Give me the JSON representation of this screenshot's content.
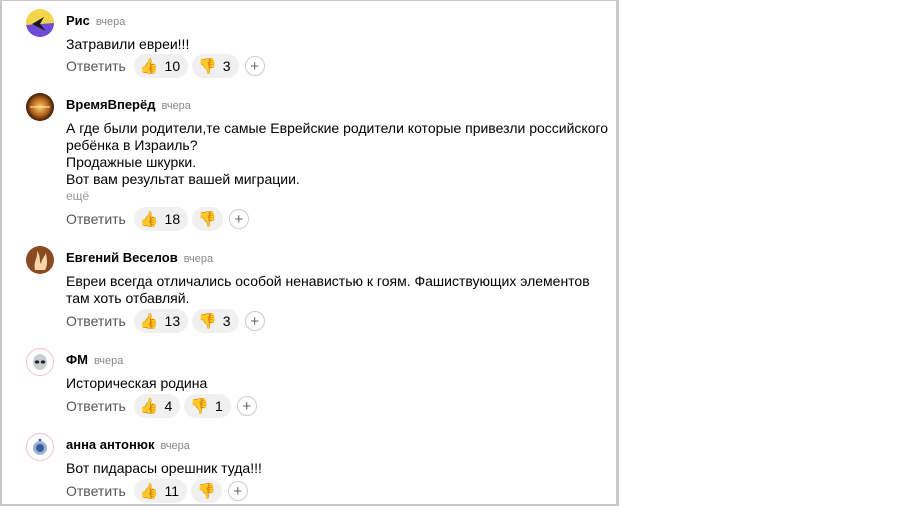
{
  "comments": [
    {
      "author": "Рис",
      "time": "вчера",
      "lines": [
        "Затравили евреи!!!"
      ],
      "more": "",
      "reply": "Ответить",
      "likes": "10",
      "dislikes": "3"
    },
    {
      "author": "ВремяВперёд",
      "time": "вчера",
      "lines": [
        "А где были родители,те самые Еврейские родители которые привезли российского",
        "ребёнка в Израиль?",
        "Продажные шкурки.",
        "Вот вам результат вашей миграции."
      ],
      "more": "ещё",
      "reply": "Ответить",
      "likes": "18",
      "dislikes": ""
    },
    {
      "author": "Евгений Веселов",
      "time": "вчера",
      "lines": [
        "Евреи всегда отличались особой ненавистью к гоям. Фашиствующих элементов",
        "там хоть отбавляй."
      ],
      "more": "",
      "reply": "Ответить",
      "likes": "13",
      "dislikes": "3"
    },
    {
      "author": "ФМ",
      "time": "вчера",
      "lines": [
        "Историческая родина"
      ],
      "more": "",
      "reply": "Ответить",
      "likes": "4",
      "dislikes": "1"
    },
    {
      "author": "анна антонюк",
      "time": "вчера",
      "lines": [
        "Вот пидарасы орешник туда!!!"
      ],
      "more": "",
      "reply": "Ответить",
      "likes": "11",
      "dislikes": ""
    }
  ],
  "icons": {
    "like": "thumbs-up-icon",
    "dislike": "thumbs-down-icon",
    "add": "plus-icon"
  },
  "colors": {
    "reaction_bg": "#f0f0f0",
    "secondary_text": "#555555"
  }
}
